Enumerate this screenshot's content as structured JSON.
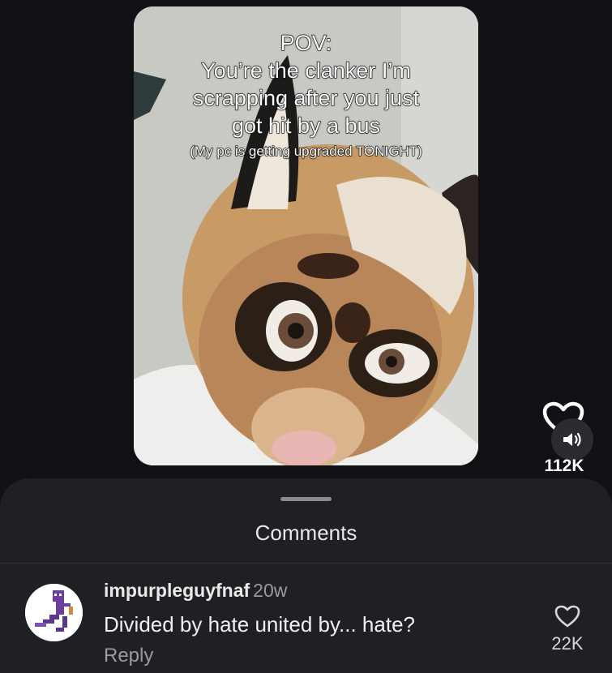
{
  "video": {
    "overlay": {
      "line1": "POV:",
      "line2": "You’re the clanker I’m",
      "line3": "scrapping after you just",
      "line4": "got hit by a bus",
      "subline": "(My pc is getting upgraded TONIGHT)"
    },
    "likes": "112K"
  },
  "icons": {
    "like": "heart-outline-icon",
    "sound": "speaker-icon",
    "comment_like": "heart-outline-icon"
  },
  "comments_sheet": {
    "title": "Comments",
    "comments": [
      {
        "username": "impurpleguyfnaf",
        "time": "20w",
        "text": "Divided by hate united by... hate?",
        "reply_label": "Reply",
        "likes": "22K"
      }
    ]
  },
  "colors": {
    "background": "#101114",
    "sheet": "#1f2023",
    "secondary_text": "#9a9ba0",
    "avatar_purple": "#6a3fa0"
  }
}
